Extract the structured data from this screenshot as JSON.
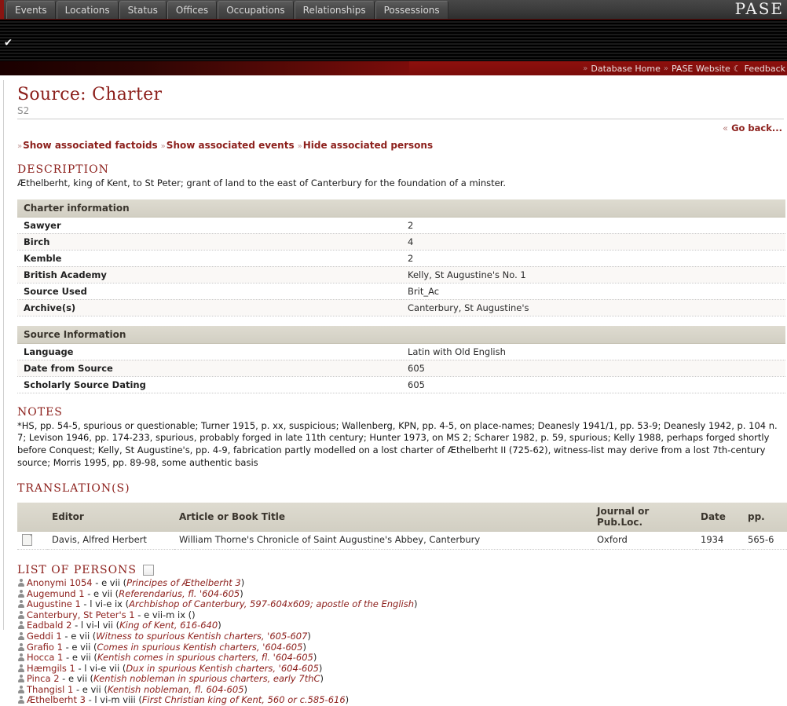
{
  "topbar": {
    "tabs": [
      {
        "label": "Events"
      },
      {
        "label": "Locations"
      },
      {
        "label": "Status"
      },
      {
        "label": "Offices"
      },
      {
        "label": "Occupations"
      },
      {
        "label": "Relationships"
      },
      {
        "label": "Possessions"
      }
    ],
    "logo": "PASE",
    "check_glyph": "✔"
  },
  "navbar": {
    "chev": "»",
    "database_home": "Database Home",
    "pase_website": "PASE Website",
    "feedback_icon": "☾",
    "feedback": "Feedback"
  },
  "header": {
    "title": "Source: Charter",
    "source_id": "S2",
    "goback_chev": "«",
    "goback": "Go back..."
  },
  "actions": {
    "chev": "»",
    "show_factoids": "Show associated factoids",
    "show_events": "Show associated events",
    "hide_persons": "Hide associated persons"
  },
  "description": {
    "heading": "DESCRIPTION",
    "text": "Æthelberht, king of Kent, to St Peter; grant of land to the east of Canterbury for the foundation of a minster."
  },
  "charter_info": {
    "caption": "Charter information",
    "rows": [
      {
        "key": "Sawyer",
        "value": "2"
      },
      {
        "key": "Birch",
        "value": "4"
      },
      {
        "key": "Kemble",
        "value": "2"
      },
      {
        "key": "British Academy",
        "value": "Kelly, St Augustine's No. 1"
      },
      {
        "key": "Source Used",
        "value": "Brit_Ac"
      },
      {
        "key": "Archive(s)",
        "value": "Canterbury, St Augustine's"
      }
    ]
  },
  "source_info": {
    "caption": "Source Information",
    "rows": [
      {
        "key": "Language",
        "value": "Latin with Old English"
      },
      {
        "key": "Date from Source",
        "value": "605"
      },
      {
        "key": "Scholarly Source Dating",
        "value": "605"
      }
    ]
  },
  "notes": {
    "heading": "NOTES",
    "text": "*HS, pp. 54-5, spurious or questionable; Turner 1915, p. xx, suspicious; Wallenberg, KPN, pp. 4-5, on place-names; Deanesly 1941/1, pp. 53-9; Deanesly 1942, p. 104 n. 7; Levison 1946, pp. 174-233, spurious, probably forged in late 11th century; Hunter 1973, on MS 2; Scharer 1982, p. 59, spurious; Kelly 1988, perhaps forged shortly before Conquest; Kelly, St Augustine's, pp. 4-9, fabrication partly modelled on a lost charter of Æthelberht II (725-62), witness-list may derive from a lost 7th-century source; Morris 1995, pp. 89-98, some authentic basis"
  },
  "translations": {
    "heading": "TRANSLATION(S)",
    "columns": [
      "",
      "Editor",
      "Article or Book Title",
      "Journal or Pub.Loc.",
      "Date",
      "pp."
    ],
    "rows": [
      {
        "icon": "document-icon",
        "editor": "Davis, Alfred Herbert",
        "title": "William Thorne's Chronicle of Saint Augustine's Abbey, Canterbury",
        "journal": "Oxford",
        "date": "1934",
        "pp": "565-6"
      }
    ]
  },
  "persons": {
    "heading": "LIST OF PERSONS",
    "items": [
      {
        "name": "Anonymi 1054",
        "dates": " - e vii (",
        "desc": "Principes of Æthelberht 3",
        "close": ")"
      },
      {
        "name": "Augemund 1",
        "dates": " - e vii (",
        "desc": "Referendarius, fl. '604-605",
        "close": ")"
      },
      {
        "name": "Augustine 1",
        "dates": " - l vi-e ix (",
        "desc": "Archbishop of Canterbury, 597-604x609; apostle of the English",
        "close": ")"
      },
      {
        "name": "Canterbury, St Peter's 1",
        "dates": " - e vii-m ix ()",
        "desc": "",
        "close": ""
      },
      {
        "name": "Eadbald 2",
        "dates": " - l vi-l vii (",
        "desc": "King of Kent, 616-640",
        "close": ")"
      },
      {
        "name": "Geddi 1",
        "dates": " - e vii (",
        "desc": "Witness to spurious Kentish charters, '605-607",
        "close": ")"
      },
      {
        "name": "Grafio 1",
        "dates": " - e vii (",
        "desc": "Comes in spurious Kentish charters, '604-605",
        "close": ")"
      },
      {
        "name": "Hocca 1",
        "dates": " - e vii (",
        "desc": "Kentish comes in spurious charters, fl. '604-605",
        "close": ")"
      },
      {
        "name": "Hæmgils 1",
        "dates": " - l vi-e vii (",
        "desc": "Dux in spurious Kentish charters, '604-605",
        "close": ")"
      },
      {
        "name": "Pinca 2",
        "dates": " - e vii (",
        "desc": "Kentish nobleman in spurious charters, early 7thC",
        "close": ")"
      },
      {
        "name": "Thangisl 1",
        "dates": " - e vii (",
        "desc": "Kentish nobleman, fl. 604-605",
        "close": ")"
      },
      {
        "name": "Æthelberht 3",
        "dates": " - l vi-m viii (",
        "desc": "First Christian king of Kent, 560 or c.585-616",
        "close": ")"
      }
    ]
  }
}
